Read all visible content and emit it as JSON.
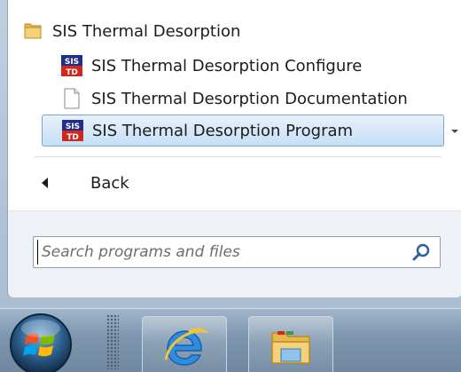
{
  "programs": {
    "folder_label": "SIS Thermal Desorption",
    "items": [
      {
        "label": "SIS Thermal Desorption Configure",
        "icon": "sis-td-app-icon"
      },
      {
        "label": "SIS Thermal Desorption Documentation",
        "icon": "document-icon"
      },
      {
        "label": "SIS Thermal Desorption Program",
        "icon": "sis-td-app-icon"
      }
    ],
    "app_icon_text_top": "SIS",
    "app_icon_text_bottom": "TD"
  },
  "back": {
    "label": "Back"
  },
  "search": {
    "placeholder": "Search programs and files"
  },
  "colors": {
    "highlight_border": "#7da2ce",
    "highlight_fill": "#d6e8f8",
    "taskbar": "#7c95ad"
  }
}
